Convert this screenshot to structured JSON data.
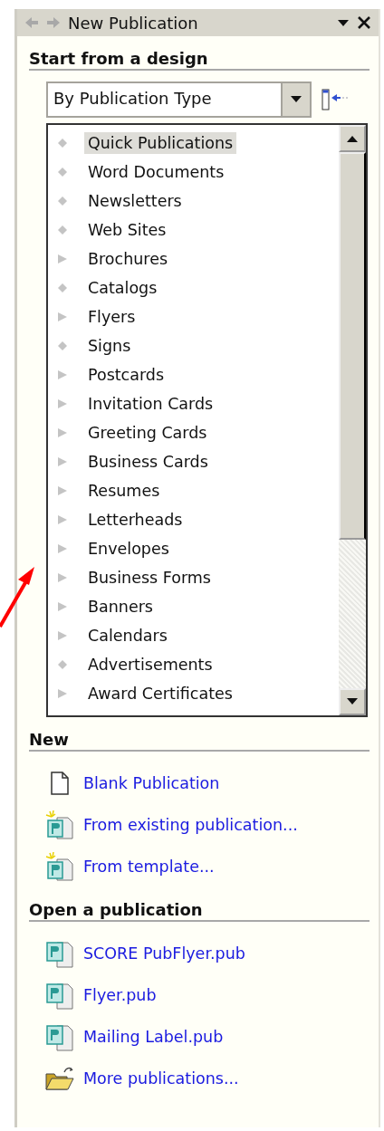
{
  "window": {
    "title": "New Publication"
  },
  "design": {
    "heading": "Start from a design",
    "dropdown": {
      "value": "By Publication Type"
    },
    "types": [
      {
        "label": "Quick Publications",
        "expandable": false,
        "selected": true
      },
      {
        "label": "Word Documents",
        "expandable": false,
        "selected": false
      },
      {
        "label": "Newsletters",
        "expandable": false,
        "selected": false
      },
      {
        "label": "Web Sites",
        "expandable": false,
        "selected": false
      },
      {
        "label": "Brochures",
        "expandable": true,
        "selected": false
      },
      {
        "label": "Catalogs",
        "expandable": false,
        "selected": false
      },
      {
        "label": "Flyers",
        "expandable": true,
        "selected": false
      },
      {
        "label": "Signs",
        "expandable": false,
        "selected": false
      },
      {
        "label": "Postcards",
        "expandable": true,
        "selected": false
      },
      {
        "label": "Invitation Cards",
        "expandable": true,
        "selected": false
      },
      {
        "label": "Greeting Cards",
        "expandable": true,
        "selected": false
      },
      {
        "label": "Business Cards",
        "expandable": true,
        "selected": false
      },
      {
        "label": "Resumes",
        "expandable": true,
        "selected": false
      },
      {
        "label": "Letterheads",
        "expandable": true,
        "selected": false
      },
      {
        "label": "Envelopes",
        "expandable": true,
        "selected": false
      },
      {
        "label": "Business Forms",
        "expandable": true,
        "selected": false
      },
      {
        "label": "Banners",
        "expandable": true,
        "selected": false
      },
      {
        "label": "Calendars",
        "expandable": true,
        "selected": false
      },
      {
        "label": "Advertisements",
        "expandable": false,
        "selected": false
      },
      {
        "label": "Award Certificates",
        "expandable": true,
        "selected": false
      }
    ]
  },
  "new": {
    "heading": "New",
    "items": [
      {
        "label": "Blank Publication",
        "kind": "blank"
      },
      {
        "label": "From existing publication...",
        "kind": "new-pub"
      },
      {
        "label": "From template...",
        "kind": "new-pub"
      }
    ]
  },
  "open": {
    "heading": "Open a publication",
    "items": [
      {
        "label": "SCORE PubFlyer.pub",
        "kind": "pub"
      },
      {
        "label": "Flyer.pub",
        "kind": "pub"
      },
      {
        "label": "Mailing Label.pub",
        "kind": "pub"
      },
      {
        "label": "More publications...",
        "kind": "folder"
      }
    ]
  }
}
